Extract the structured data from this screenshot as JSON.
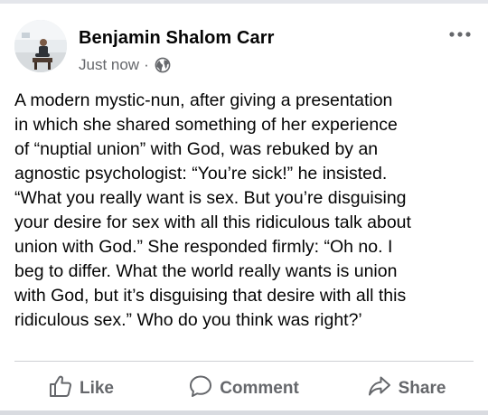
{
  "post": {
    "author": "Benjamin Shalom Carr",
    "timestamp": "Just now",
    "separator": "·",
    "audience_icon": "globe-icon",
    "menu_icon": "more-options-icon",
    "body_lines": [
      "A modern mystic-nun, after giving a presentation",
      "in which she shared something of her experience",
      "of “nuptial union” with God, was rebuked by an",
      "agnostic psychologist: “You’re sick!” he insisted.",
      "“What you really want is sex. But you’re disguising",
      "your desire for sex with all this ridiculous talk about",
      "union with God.” She responded firmly: “Oh no. I",
      "beg to differ. What the world really wants is union",
      "with God, but it’s disguising that desire with all this",
      "ridiculous sex.” Who do you think was right?’"
    ]
  },
  "actions": {
    "like": {
      "label": "Like",
      "icon": "thumbs-up-icon"
    },
    "comment": {
      "label": "Comment",
      "icon": "comment-icon"
    },
    "share": {
      "label": "Share",
      "icon": "share-arrow-icon"
    }
  },
  "colors": {
    "text_primary": "#050505",
    "text_secondary": "#65676b",
    "divider": "#ced0d4"
  }
}
